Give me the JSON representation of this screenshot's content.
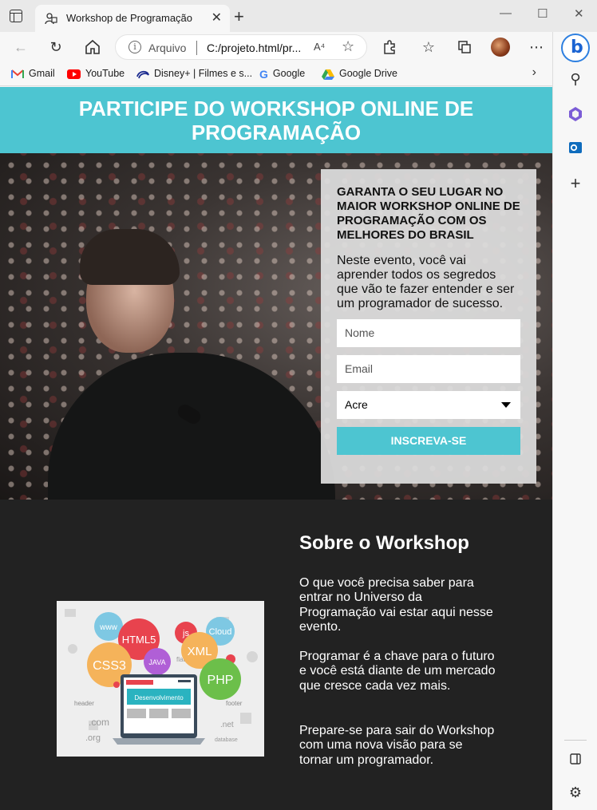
{
  "browser": {
    "tab_title": "Workshop de Programação",
    "url_prefix": "Arquivo",
    "url": "C:/projeto.html/pr...",
    "read_aloud": "A⁴",
    "bookmarks": [
      {
        "label": "Gmail",
        "icon": "gmail-icon"
      },
      {
        "label": "YouTube",
        "icon": "youtube-icon"
      },
      {
        "label": "Disney+ | Filmes e s...",
        "icon": "disney-icon"
      },
      {
        "label": "Google",
        "icon": "google-icon"
      },
      {
        "label": "Google Drive",
        "icon": "google-drive-icon"
      }
    ]
  },
  "hero": {
    "title": "PARTICIPE DO WORKSHOP ONLINE DE PROGRAMAÇÃO"
  },
  "form": {
    "title": "GARANTA O SEU LUGAR NO MAIOR WORKSHOP ONLINE DE PROGRAMAÇÃO COM OS MELHORES DO BRASIL",
    "text": "Neste evento, você vai aprender todos os segredos que vão te fazer entender e ser um programador de sucesso.",
    "name_placeholder": "Nome",
    "email_placeholder": "Email",
    "state_selected": "Acre",
    "submit_label": "INSCREVA-SE"
  },
  "about": {
    "title": "Sobre o Workshop",
    "paragraphs": [
      "O que você precisa saber para entrar no Universo da Programação vai estar aqui nesse evento.",
      "Programar é a chave para o futuro e você está diante de um mercado que cresce cada vez mais.",
      "Prepare-se para sair do Workshop com uma nova visão para se tornar um programador."
    ],
    "image_labels": {
      "www": "www",
      "html5": "HTML5",
      "js": "js",
      "cloud": "Cloud",
      "css3": "CSS3",
      "java": "JAVA",
      "flat": "flat",
      "xml": "XML",
      "php": "PHP",
      "desenvolvimento": "Desenvolvimento",
      "header": "header",
      "footer": "footer",
      "com": ".com",
      "org": ".org",
      "net": ".net",
      "database": "database"
    }
  },
  "colors": {
    "accent": "#4dc5d1",
    "dark": "#222222"
  }
}
